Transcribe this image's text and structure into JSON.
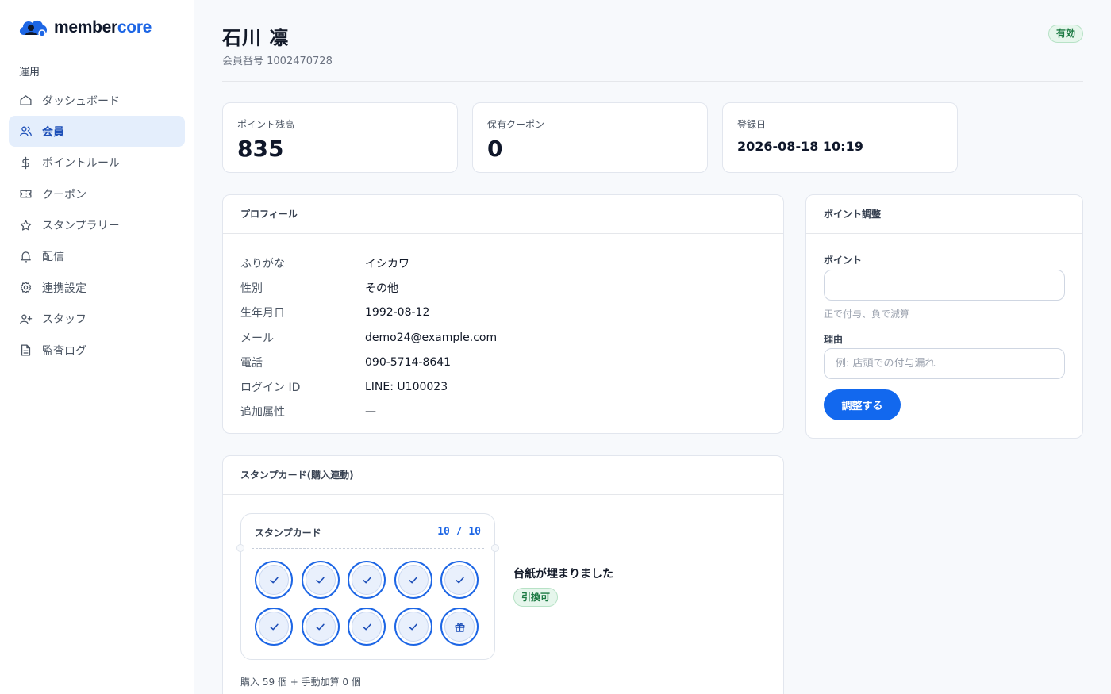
{
  "app": {
    "logo_main": "member",
    "logo_accent": "core"
  },
  "sidebar": {
    "section": "運用",
    "items": [
      {
        "label": "ダッシュボード",
        "icon": "home-icon"
      },
      {
        "label": "会員",
        "icon": "users-icon",
        "active": true
      },
      {
        "label": "ポイントルール",
        "icon": "dollar-icon"
      },
      {
        "label": "クーポン",
        "icon": "ticket-icon"
      },
      {
        "label": "スタンプラリー",
        "icon": "star-icon"
      },
      {
        "label": "配信",
        "icon": "bell-icon"
      },
      {
        "label": "連携設定",
        "icon": "gear-icon"
      },
      {
        "label": "スタッフ",
        "icon": "user-plus-icon"
      },
      {
        "label": "監査ログ",
        "icon": "document-icon"
      }
    ]
  },
  "member": {
    "name": "石川 凛",
    "number": "会員番号 1002470728",
    "status": "有効"
  },
  "stats": [
    {
      "label": "ポイント残高",
      "value": "835"
    },
    {
      "label": "保有クーポン",
      "value": "0"
    },
    {
      "label": "登録日",
      "value": "2026-08-18 10:19"
    }
  ],
  "profile": {
    "title": "プロフィール",
    "rows": [
      {
        "k": "ふりがな",
        "v": "イシカワ"
      },
      {
        "k": "性別",
        "v": "その他"
      },
      {
        "k": "生年月日",
        "v": "1992-08-12"
      },
      {
        "k": "メール",
        "v": "demo24@example.com"
      },
      {
        "k": "電話",
        "v": "090-5714-8641"
      },
      {
        "k": "ログイン ID",
        "v": "LINE: U100023"
      },
      {
        "k": "追加属性",
        "v": "—"
      }
    ]
  },
  "adjust": {
    "title": "ポイント調整",
    "points_label": "ポイント",
    "points_value": "",
    "points_hint": "正で付与、負で減算",
    "reason_label": "理由",
    "reason_placeholder": "例: 店頭での付与漏れ",
    "button": "調整する"
  },
  "stampcard": {
    "title": "スタンプカード(購入連動)",
    "card_title": "スタンプカード",
    "count": "10 / 10",
    "filled": 10,
    "total": 10,
    "status": "台紙が埋まりました",
    "badge": "引換可",
    "summary": "購入 59 個 + 手動加算 0 個"
  },
  "colors": {
    "accent": "#1d66e5",
    "success": "#1c7a43"
  }
}
